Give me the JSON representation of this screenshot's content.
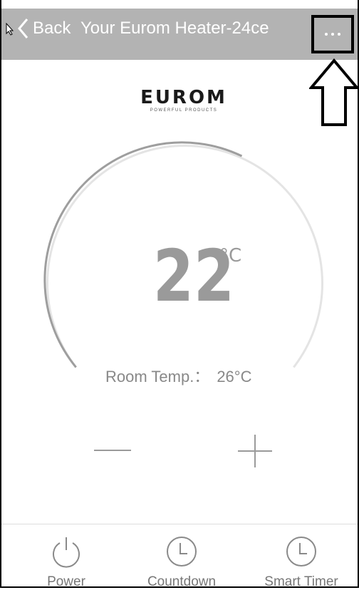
{
  "header": {
    "back_label": "Back",
    "title": "Your Eurom Heater-24ce",
    "more_icon": "more-dots-icon"
  },
  "logo": {
    "word": "EUROM",
    "tagline": "POWERFUL PRODUCTS"
  },
  "thermostat": {
    "set_temp": "22",
    "unit": "°C",
    "room_label": "Room Temp.：",
    "room_value": "26°C",
    "minus_icon": "minus-icon",
    "plus_icon": "plus-icon"
  },
  "tabs": [
    {
      "label": "Power",
      "icon": "power-icon"
    },
    {
      "label": "Countdown",
      "icon": "clock-icon"
    },
    {
      "label": "Smart Timer",
      "icon": "clock-icon"
    }
  ],
  "colors": {
    "header_bg": "#b3b3b3",
    "temp_text": "#9a9a9a",
    "dial_arc": "#9e9e9e",
    "dial_track": "#e4e4e4"
  }
}
